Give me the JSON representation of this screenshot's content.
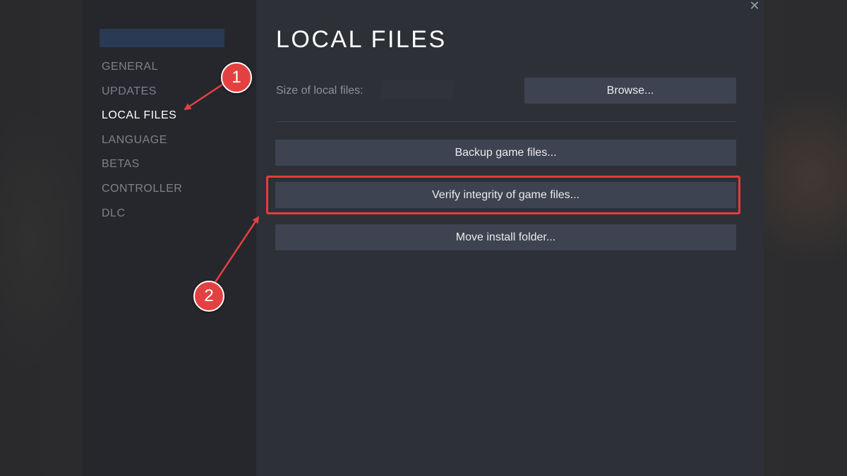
{
  "window": {
    "close_glyph": "✕"
  },
  "sidebar": {
    "items": [
      {
        "label": "GENERAL",
        "active": false
      },
      {
        "label": "UPDATES",
        "active": false
      },
      {
        "label": "LOCAL FILES",
        "active": true
      },
      {
        "label": "LANGUAGE",
        "active": false
      },
      {
        "label": "BETAS",
        "active": false
      },
      {
        "label": "CONTROLLER",
        "active": false
      },
      {
        "label": "DLC",
        "active": false
      }
    ]
  },
  "main": {
    "title": "LOCAL FILES",
    "size_label": "Size of local files:",
    "browse_label": "Browse...",
    "buttons": {
      "backup": "Backup game files...",
      "verify": "Verify integrity of game files...",
      "move": "Move install folder..."
    }
  },
  "annotations": {
    "badge_1": "1",
    "badge_2": "2",
    "highlight_color": "#e53c3c",
    "badge_color": "#e34141"
  },
  "colors": {
    "sidebar_bg": "#25272c",
    "panel_bg": "#2d3037",
    "button_bg": "#3d4350",
    "active_text": "#ffffff",
    "inactive_text": "#7c8189"
  }
}
